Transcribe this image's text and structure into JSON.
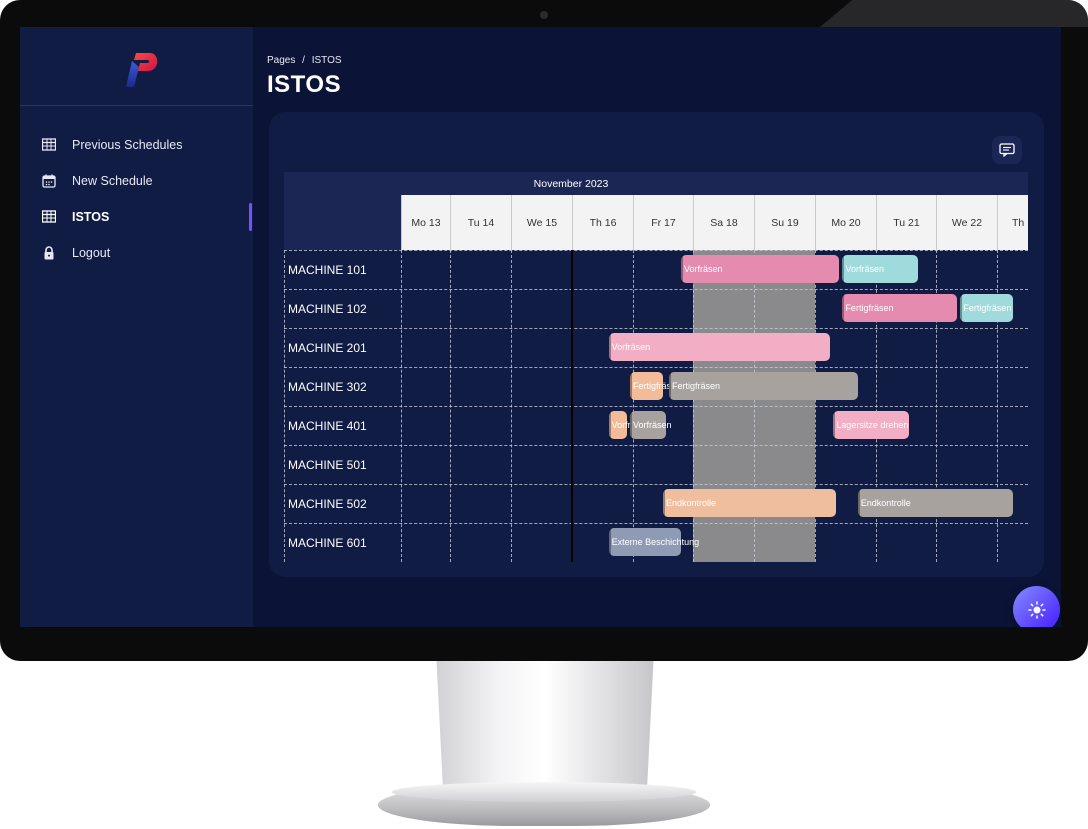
{
  "sidebar": {
    "items": [
      {
        "label": "Previous Schedules",
        "icon": "table-icon"
      },
      {
        "label": "New Schedule",
        "icon": "calendar-icon"
      },
      {
        "label": "ISTOS",
        "icon": "table-icon",
        "active": true
      },
      {
        "label": "Logout",
        "icon": "lock-icon"
      }
    ]
  },
  "header": {
    "breadcrumb_root": "Pages",
    "breadcrumb_sep": "/",
    "breadcrumb_current": "ISTOS",
    "title": "ISTOS"
  },
  "gantt": {
    "month": "November 2023",
    "days": [
      "Mo 13",
      "Tu 14",
      "We 15",
      "Th 16",
      "Fr 17",
      "Sa 18",
      "Su 19",
      "Mo 20",
      "Tu 21",
      "We 22",
      "Th"
    ],
    "machines": [
      "MACHINE 101",
      "MACHINE 102",
      "MACHINE 201",
      "MACHINE 302",
      "MACHINE 401",
      "MACHINE 501",
      "MACHINE 502",
      "MACHINE 601"
    ],
    "tasks": [
      {
        "row": 0,
        "start": 4.8,
        "end": 7.4,
        "label": "Vorfräsen",
        "color": "#e68bb0"
      },
      {
        "row": 0,
        "start": 7.45,
        "end": 8.7,
        "label": "Vorfräsen",
        "color": "#9fdbdc"
      },
      {
        "row": 1,
        "start": 7.45,
        "end": 9.35,
        "label": "Fertigfräsen",
        "color": "#e68bb0"
      },
      {
        "row": 1,
        "start": 9.4,
        "end": 10.55,
        "label": "Fertigfräsen",
        "color": "#9fdbdc"
      },
      {
        "row": 2,
        "start": 3.6,
        "end": 7.25,
        "label": "Vorfräsen",
        "color": "#f2aec4"
      },
      {
        "row": 3,
        "start": 3.95,
        "end": 4.5,
        "label": "Fertigfräsen",
        "color": "#f2bc9a"
      },
      {
        "row": 3,
        "start": 4.6,
        "end": 7.7,
        "label": "Fertigfräsen",
        "color": "#a8a29f"
      },
      {
        "row": 4,
        "start": 3.6,
        "end": 3.9,
        "label": "Vorfräsen",
        "color": "#f2bc9a"
      },
      {
        "row": 4,
        "start": 3.95,
        "end": 4.55,
        "label": "Vorfräsen",
        "color": "#a8a29f"
      },
      {
        "row": 4,
        "start": 7.3,
        "end": 8.55,
        "label": "Lagersitze drehen",
        "color": "#f2aec4"
      },
      {
        "row": 6,
        "start": 4.5,
        "end": 7.35,
        "label": "Endkontrolle",
        "color": "#efbe9f"
      },
      {
        "row": 6,
        "start": 7.7,
        "end": 10.55,
        "label": "Endkontrolle",
        "color": "#a8a29f"
      },
      {
        "row": 7,
        "start": 3.6,
        "end": 4.8,
        "label": "Externe Beschichtung",
        "color": "#8f9bb5"
      }
    ]
  },
  "colors": {
    "screen_bg": "#0b1437",
    "sidebar_bg": "#111c44",
    "accent": "#7551ff",
    "weekend": "#8a8a8c"
  }
}
